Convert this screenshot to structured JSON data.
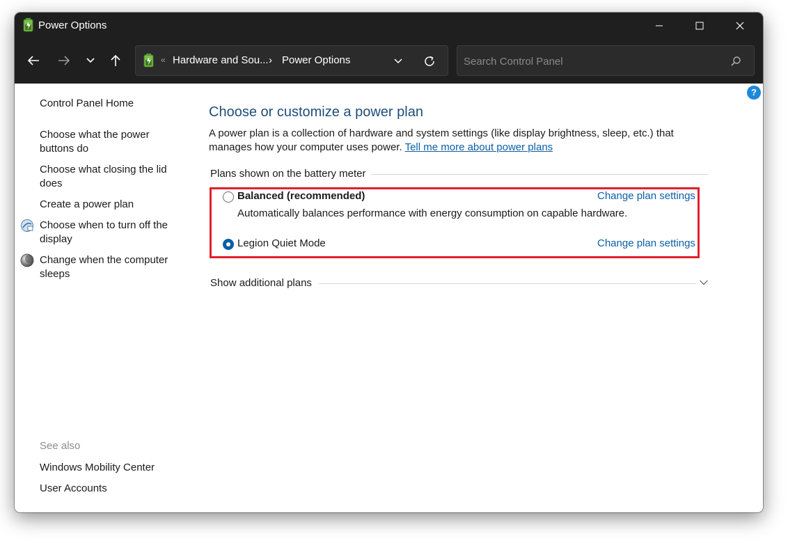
{
  "window": {
    "title": "Power Options",
    "controls": {
      "minimize_icon": "minimize-icon",
      "maximize_icon": "maximize-icon",
      "close_icon": "close-icon"
    }
  },
  "navbar": {
    "address": {
      "overflow_marker": "«",
      "crumbs": [
        "Hardware and Sou...",
        "Power Options"
      ],
      "separator": "›"
    },
    "search": {
      "placeholder": "Search Control Panel"
    }
  },
  "help": {
    "label": "?"
  },
  "sidebar": {
    "items": [
      {
        "label": "Control Panel Home"
      },
      {
        "label": "Choose what the power buttons do"
      },
      {
        "label": "Choose what closing the lid does"
      },
      {
        "label": "Create a power plan"
      },
      {
        "label": "Choose when to turn off the display",
        "icon": "display-power-icon"
      },
      {
        "label": "Change when the computer sleeps",
        "icon": "sleep-moon-icon"
      }
    ],
    "see_also": {
      "heading": "See also",
      "items": [
        {
          "label": "Windows Mobility Center"
        },
        {
          "label": "User Accounts"
        }
      ]
    }
  },
  "main": {
    "title": "Choose or customize a power plan",
    "description": "A power plan is a collection of hardware and system settings (like display brightness, sleep, etc.) that manages how your computer uses power.",
    "learn_more": "Tell me more about power plans",
    "plans_section_label": "Plans shown on the battery meter",
    "plans": [
      {
        "name": "Balanced (recommended)",
        "selected": false,
        "description": "Automatically balances performance with energy consumption on capable hardware.",
        "change_link": "Change plan settings"
      },
      {
        "name": "Legion Quiet Mode",
        "selected": true,
        "description": "",
        "change_link": "Change plan settings"
      }
    ],
    "show_additional": "Show additional plans"
  },
  "colors": {
    "titlebar_bg": "#1f1f1f",
    "link_blue": "#0b5fa5",
    "title_blue": "#1e4e79",
    "highlight_red": "#e0202a",
    "help_blue": "#1e88d9"
  }
}
